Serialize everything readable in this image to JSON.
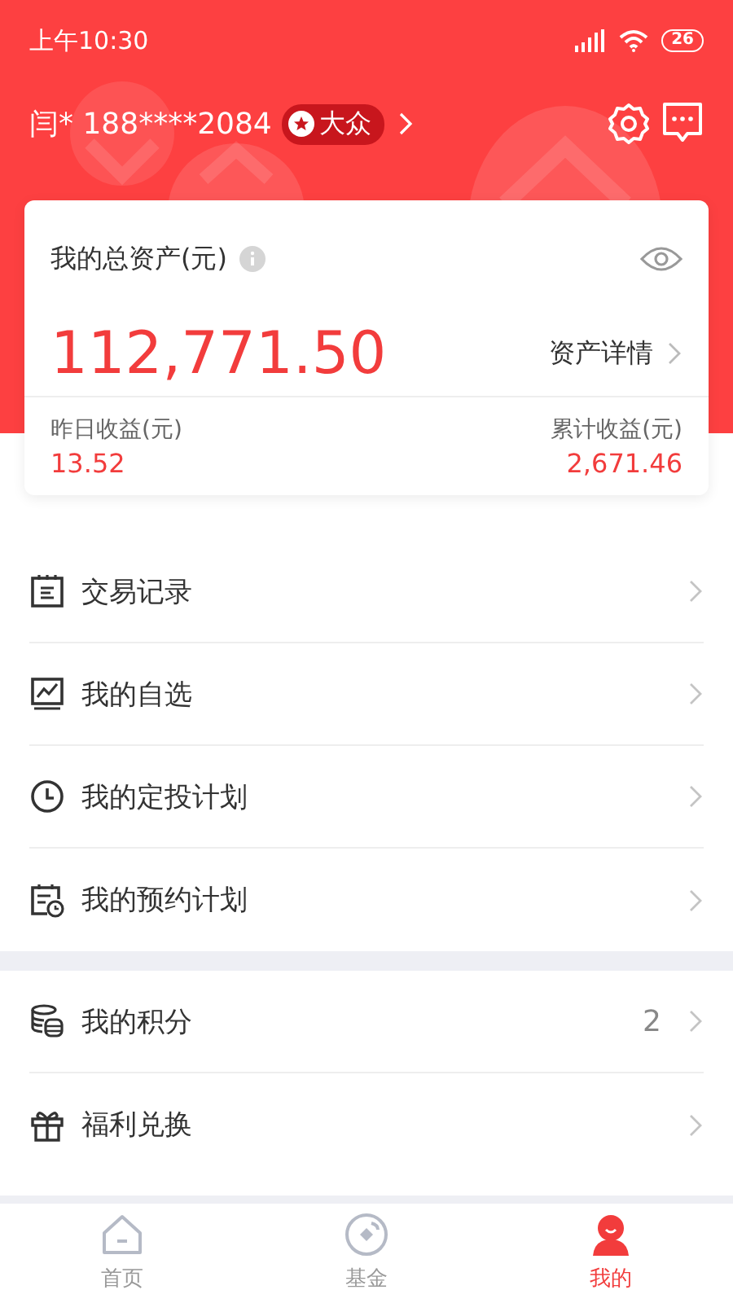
{
  "status_bar": {
    "time": "上午10:30",
    "battery": "26"
  },
  "header": {
    "user": "闫* 188****2084",
    "level_badge": "大众"
  },
  "asset_card": {
    "title": "我的总资产(元)",
    "total": "112,771.50",
    "detail_link": "资产详情",
    "yesterday_label": "昨日收益(元)",
    "yesterday_value": "13.52",
    "cumulative_label": "累计收益(元)",
    "cumulative_value": "2,671.46"
  },
  "menu_groups": [
    {
      "items": [
        {
          "kind": "records",
          "label": "交易记录"
        },
        {
          "kind": "watchlist",
          "label": "我的自选"
        },
        {
          "kind": "plan",
          "label": "我的定投计划"
        },
        {
          "kind": "appointment",
          "label": "我的预约计划"
        }
      ]
    },
    {
      "items": [
        {
          "kind": "points",
          "label": "我的积分",
          "value": "2"
        },
        {
          "kind": "gift",
          "label": "福利兑换"
        }
      ]
    }
  ],
  "tab_bar": [
    {
      "kind": "home",
      "label": "首页",
      "selected": false
    },
    {
      "kind": "fund",
      "label": "基金",
      "selected": false
    },
    {
      "kind": "me",
      "label": "我的",
      "selected": true
    }
  ]
}
